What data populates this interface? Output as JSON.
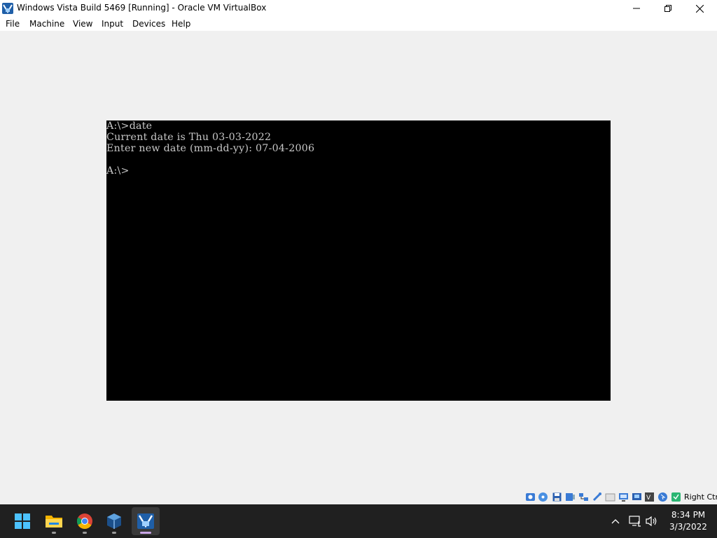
{
  "window": {
    "title": "Windows Vista Build 5469 [Running] - Oracle VM VirtualBox",
    "icon": "virtualbox-vista-icon"
  },
  "menu": {
    "items": [
      "File",
      "Machine",
      "View",
      "Input",
      "Devices",
      "Help"
    ]
  },
  "console": {
    "lines": [
      "A:\\>date",
      "Current date is Thu 03-03-2022",
      "Enter new date (mm-dd-yy): 07-04-2006",
      "",
      "A:\\>"
    ]
  },
  "statusbar": {
    "icons": [
      "hard-disk-icon",
      "optical-drive-icon",
      "floppy-icon",
      "audio-icon",
      "network-icon",
      "usb-icon",
      "shared-folders-icon",
      "display-icon",
      "video-capture-icon",
      "virtualization-icon",
      "mouse-integration-icon",
      "keyboard-capture-icon"
    ],
    "host_key": "Right Ctrl"
  },
  "taskbar": {
    "apps": [
      "start-icon",
      "file-explorer-icon",
      "chrome-icon",
      "virtualbox-icon",
      "vista-vm-icon"
    ],
    "tray": [
      "chevron-up-icon",
      "network-icon",
      "volume-icon"
    ],
    "time": "8:34 PM",
    "date": "3/3/2022"
  },
  "colors": {
    "console_bg": "#000000",
    "console_text": "#c8c8c8",
    "taskbar_bg": "#202020",
    "accent": "#0078d4"
  }
}
